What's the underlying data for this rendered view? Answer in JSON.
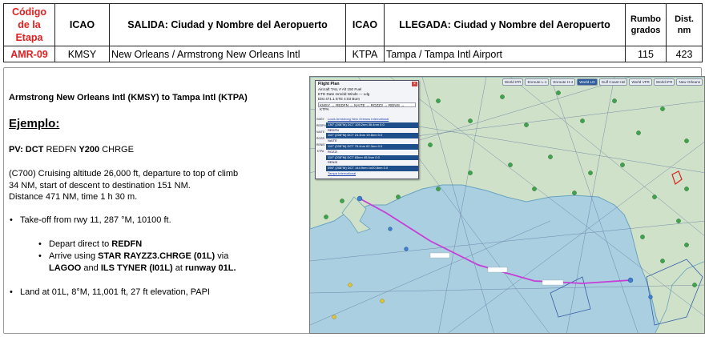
{
  "table": {
    "headers": {
      "code": "Código de la Etapa",
      "icao_dep": "ICAO",
      "departure": "SALIDA: Ciudad y Nombre del Aeropuerto",
      "icao_arr": "ICAO",
      "arrival": "LLEGADA: Ciudad y Nombre del Aeropuerto",
      "heading": "Rumbo grados",
      "distance": "Dist. nm"
    },
    "row": {
      "code": "AMR-09",
      "icao_dep": "KMSY",
      "departure": "New Orleans / Armstrong New Orleans Intl",
      "icao_arr": "KTPA",
      "arrival": "Tampa / Tampa Intl Airport",
      "heading": "115",
      "distance": "423"
    }
  },
  "briefing": {
    "route_title": "Armstrong New Orleans Intl (KMSY) to Tampa Intl (KTPA)",
    "example_heading": "Ejemplo:",
    "pv_label": "PV:",
    "pv_dct": "DCT",
    "pv_fix1": "REDFN",
    "pv_airway": "Y200",
    "pv_fix2": "CHRGE",
    "cruise_line1": "(C700) Cruising altitude 26,000 ft, departure to top of climb",
    "cruise_line2": "34 NM, start of descent to destination 151 NM.",
    "cruise_line3": "Distance 471 NM, time 1 h 30 m.",
    "takeoff": "Take-off from rwy 11, 287 °M, 10100 ft.",
    "depart_prefix": "Depart direct to ",
    "depart_fix": "REDFN",
    "arrive_prefix": "Arrive using ",
    "arrive_star": "STAR RAYZZ3.CHRGE (01L)",
    "arrive_via": " via",
    "arrive_lagoo": "LAGOO",
    "arrive_and": " and ",
    "arrive_ils": "ILS TYNER (I01L)",
    "arrive_at": " at ",
    "arrive_rwy": "runway 01L.",
    "land": "Land at 01L, 8°M, 11,001 ft, 27 ft elevation, PAPI"
  },
  "map": {
    "toolbar": [
      "World IFR",
      "Enroute L-1",
      "Enroute H-4",
      "World LO",
      "Gulf Coast Hel",
      "World VFR",
      "World IFR",
      "New Orleans"
    ],
    "active_tab_index": 3,
    "flight_plan": {
      "title": "Flight Plan",
      "aircraft_row": "Aircraft   TAIL #     Alt   150   Fuel",
      "etd_row": "ETD   Date  mm/dd   Winds   —   Ldg",
      "dist_row": "Dist  471.1   ETE  4:03   Burn",
      "route": "KMSY → REDFN → NAITE → ROZZ3 → RENIS → KTPA",
      "sidebar": [
        "KMSY",
        "REDFN",
        "NAITE",
        "ROZZI",
        "RENIS",
        "KTPA"
      ],
      "legs": [
        "Louis Armstrong New Orleans International",
        "130° (208°M)    DCT   105.2nm   36.4nm    0.0",
        "REDFN",
        "110° (208°M)    DCT   24.3nm   19.8nm    0.0",
        "NAITE",
        "110° (208°M)    DCT   76.4nm   62.3nm    0.0",
        "ROZZI",
        "110° (208°M)    DCT   83nm   45.5nm    0.0",
        "RENIS",
        "096° (208°M)    DCT   144.9nm   1n20.8nm    0.0",
        "Tampa International"
      ]
    }
  }
}
